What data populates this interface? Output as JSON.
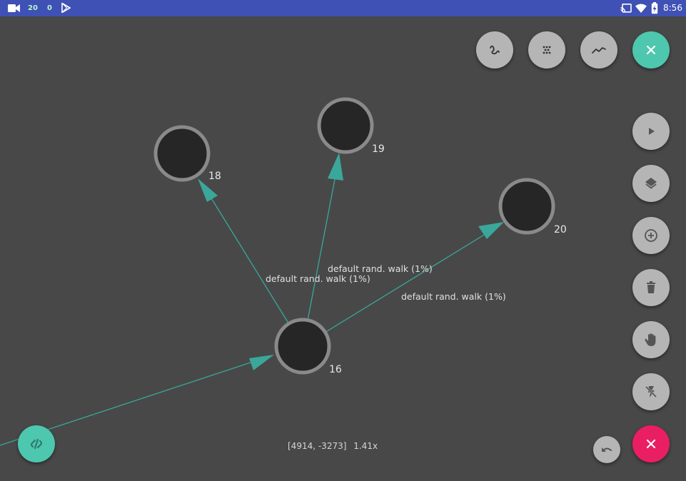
{
  "status_bar": {
    "notif_count_1": "20",
    "notif_count_2": "0",
    "time": "8:56"
  },
  "graph": {
    "nodes": [
      {
        "id": "16",
        "label": "16"
      },
      {
        "id": "18",
        "label": "18"
      },
      {
        "id": "19",
        "label": "19"
      },
      {
        "id": "20",
        "label": "20"
      }
    ],
    "edges": [
      {
        "from": "16",
        "to": "18",
        "label": "default rand. walk (1%)"
      },
      {
        "from": "16",
        "to": "19",
        "label": "default rand. walk (1%)"
      },
      {
        "from": "16",
        "to": "20",
        "label": "default rand. walk (1%)"
      },
      {
        "from": "offscreen",
        "to": "16",
        "label": ""
      }
    ]
  },
  "viewport": {
    "coordinates": "[4914, -3273]",
    "zoom": "1.41x"
  },
  "toolbar_top": [
    {
      "name": "squiggle-mode-button",
      "icon": "squiggle-icon"
    },
    {
      "name": "scatter-mode-button",
      "icon": "scatter-icon"
    },
    {
      "name": "trend-mode-button",
      "icon": "trend-line-icon"
    },
    {
      "name": "close-top-button",
      "icon": "close-icon"
    }
  ],
  "toolbar_side": [
    {
      "name": "play-button",
      "icon": "play-icon"
    },
    {
      "name": "layers-button",
      "icon": "layers-icon"
    },
    {
      "name": "add-node-button",
      "icon": "add-circle-icon"
    },
    {
      "name": "delete-button",
      "icon": "trash-icon"
    },
    {
      "name": "pan-button",
      "icon": "hand-icon"
    },
    {
      "name": "flash-off-button",
      "icon": "flash-off-icon"
    }
  ],
  "colors": {
    "background": "#484848",
    "edge": "#3aa79a",
    "node_fill": "#262626",
    "node_ring": "#8a8a8a",
    "fab_gray": "#b5b5b5",
    "fab_teal": "#4dc7ad",
    "fab_pink": "#e91e63",
    "status_bar": "#3f51b5"
  }
}
